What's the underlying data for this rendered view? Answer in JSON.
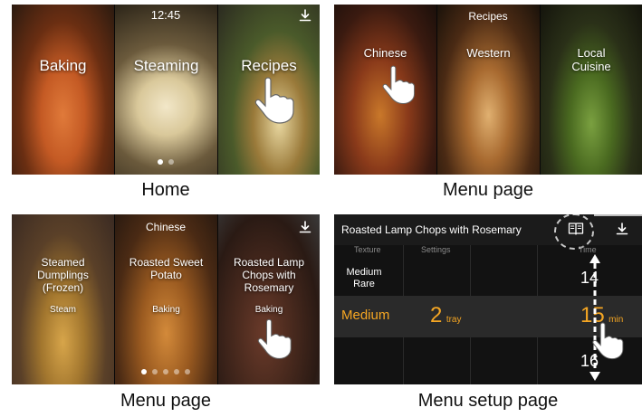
{
  "home": {
    "caption": "Home",
    "time": "12:45",
    "panels": [
      {
        "label": "Baking"
      },
      {
        "label": "Steaming"
      },
      {
        "label": "Recipes"
      }
    ]
  },
  "menu_page_1": {
    "caption": "Menu page",
    "title": "Recipes",
    "panels": [
      {
        "label": "Chinese"
      },
      {
        "label": "Western"
      },
      {
        "label": "Local Cuisine"
      }
    ]
  },
  "menu_page_2": {
    "caption": "Menu page",
    "title": "Chinese",
    "panels": [
      {
        "label": "Steamed Dumplings (Frozen)",
        "sub": "Steam"
      },
      {
        "label": "Roasted Sweet Potato",
        "sub": "Baking"
      },
      {
        "label": "Roasted Lamp Chops with Rosemary",
        "sub": "Baking"
      }
    ]
  },
  "setup_page": {
    "caption": "Menu setup page",
    "title": "Roasted Lamp Chops with Rosemary",
    "columns": {
      "texture": "Texture",
      "settings": "Settings",
      "time": "Time"
    },
    "rows": [
      {
        "texture": "Medium Rare",
        "setting_value": "",
        "setting_unit": "",
        "time_value": "14",
        "time_unit": ""
      },
      {
        "texture": "Medium",
        "setting_value": "2",
        "setting_unit": "tray",
        "time_value": "15",
        "time_unit": "min"
      },
      {
        "texture": "",
        "setting_value": "",
        "setting_unit": "",
        "time_value": "16",
        "time_unit": ""
      }
    ]
  },
  "colors": {
    "accent_orange": "#f5a623",
    "screen_bg": "#111111"
  },
  "icons": [
    "download-icon",
    "recipe-book-icon",
    "hand-pointer-icon",
    "scroll-arrow-icon"
  ]
}
